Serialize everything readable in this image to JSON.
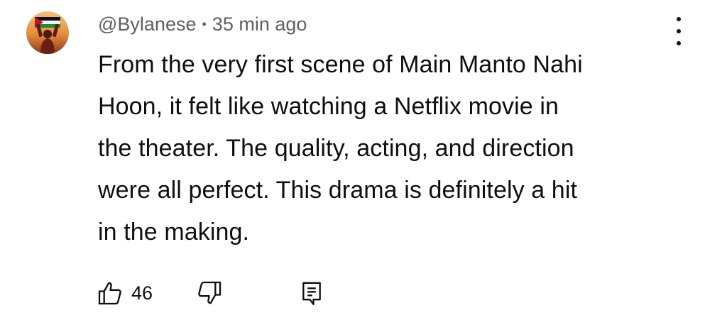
{
  "comment": {
    "author": "@Bylanese",
    "separator": "•",
    "timestamp": "35 min ago",
    "text_lines": [
      "From the very first scene of Main Manto Nahi",
      "Hoon, it felt like watching a Netflix movie in",
      "the theater. The quality, acting, and direction",
      "were all perfect. This drama is definitely a hit",
      "in the making."
    ],
    "likes": "46"
  },
  "icons": {
    "avatar": "avatar-person-with-flag",
    "menu": "more-vertical-icon",
    "like": "thumb-up-icon",
    "dislike": "thumb-down-icon",
    "reply": "reply-comment-icon"
  },
  "colors": {
    "text": "#0f0f0f",
    "meta": "#606060",
    "background": "#ffffff"
  }
}
